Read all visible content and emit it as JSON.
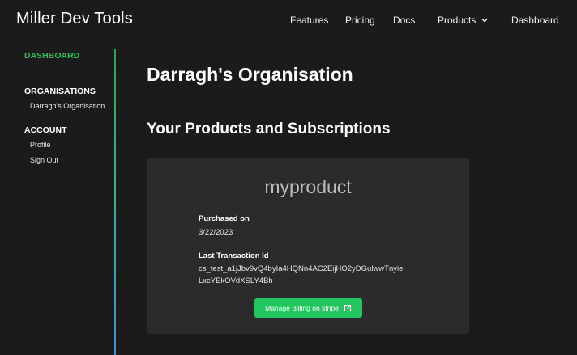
{
  "header": {
    "brand": "Miller Dev Tools",
    "nav": {
      "features": "Features",
      "pricing": "Pricing",
      "docs": "Docs",
      "products": "Products",
      "dashboard": "Dashboard"
    }
  },
  "sidebar": {
    "dashboard": "DASHBOARD",
    "organisations_heading": "ORGANISATIONS",
    "organisation_item": "Darragh's Organisation",
    "account_heading": "ACCOUNT",
    "profile": "Profile",
    "sign_out": "Sign Out"
  },
  "main": {
    "title": "Darragh's Organisation",
    "section_title": "Your Products and Subscriptions",
    "product_card": {
      "name": "myproduct",
      "purchased_label": "Purchased on",
      "purchased_value": "3/22/2023",
      "transaction_label": "Last Transaction Id",
      "transaction_value_line1": "cs_test_a1jJbv9vQ4byIa4HQNn4AC2EijHO2yDGulwwTnyiei",
      "transaction_value_line2": "LxcYEkOVdXSLY4Bh",
      "billing_button": "Manage Billing on stripe"
    }
  },
  "icons": {
    "products_chevron": "chevron-down-icon",
    "billing_link": "external-link-icon"
  },
  "colors": {
    "background": "#1b1b1b",
    "card": "#2b2b2b",
    "accent_green": "#22c55e",
    "sidebar_active": "#2fbf5a"
  }
}
